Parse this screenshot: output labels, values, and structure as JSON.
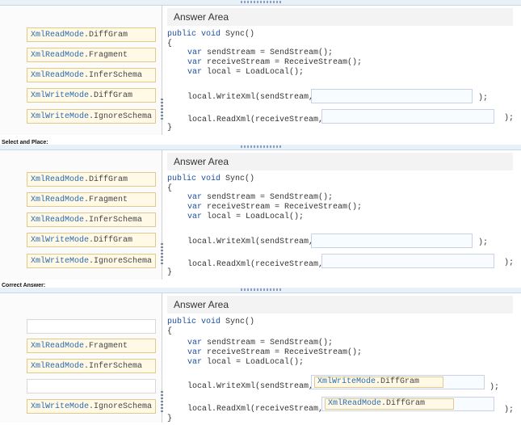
{
  "answer_area_title": "Answer Area",
  "section_labels": {
    "select_and_place": "Select and Place:",
    "correct_answer": "Correct Answer:"
  },
  "code": {
    "signature_kw": "public void",
    "signature_name": " Sync()",
    "brace_open": "{",
    "brace_close": "}",
    "line1_kw": "var",
    "line1_rest": " sendStream = SendStream();",
    "line2_kw": "var",
    "line2_rest": " receiveStream = ReceiveStream();",
    "line3_kw": "var",
    "line3_rest": " local = LoadLocal();",
    "write_call": "local.WriteXml(sendStream,",
    "read_call": "local.ReadXml(receiveStream,",
    "tail": ");"
  },
  "options": [
    {
      "enum": "XmlReadMode",
      "member": ".DiffGram"
    },
    {
      "enum": "XmlReadMode",
      "member": ".Fragment"
    },
    {
      "enum": "XmlReadMode",
      "member": ".InferSchema"
    },
    {
      "enum": "XmlWriteMode",
      "member": ".DiffGram"
    },
    {
      "enum": "XmlWriteMode",
      "member": ".IgnoreSchema"
    }
  ],
  "correct": {
    "write_enum": "XmlWriteMode",
    "write_member": ".DiffGram",
    "read_enum": "XmlReadMode",
    "read_member": ".DiffGram"
  }
}
